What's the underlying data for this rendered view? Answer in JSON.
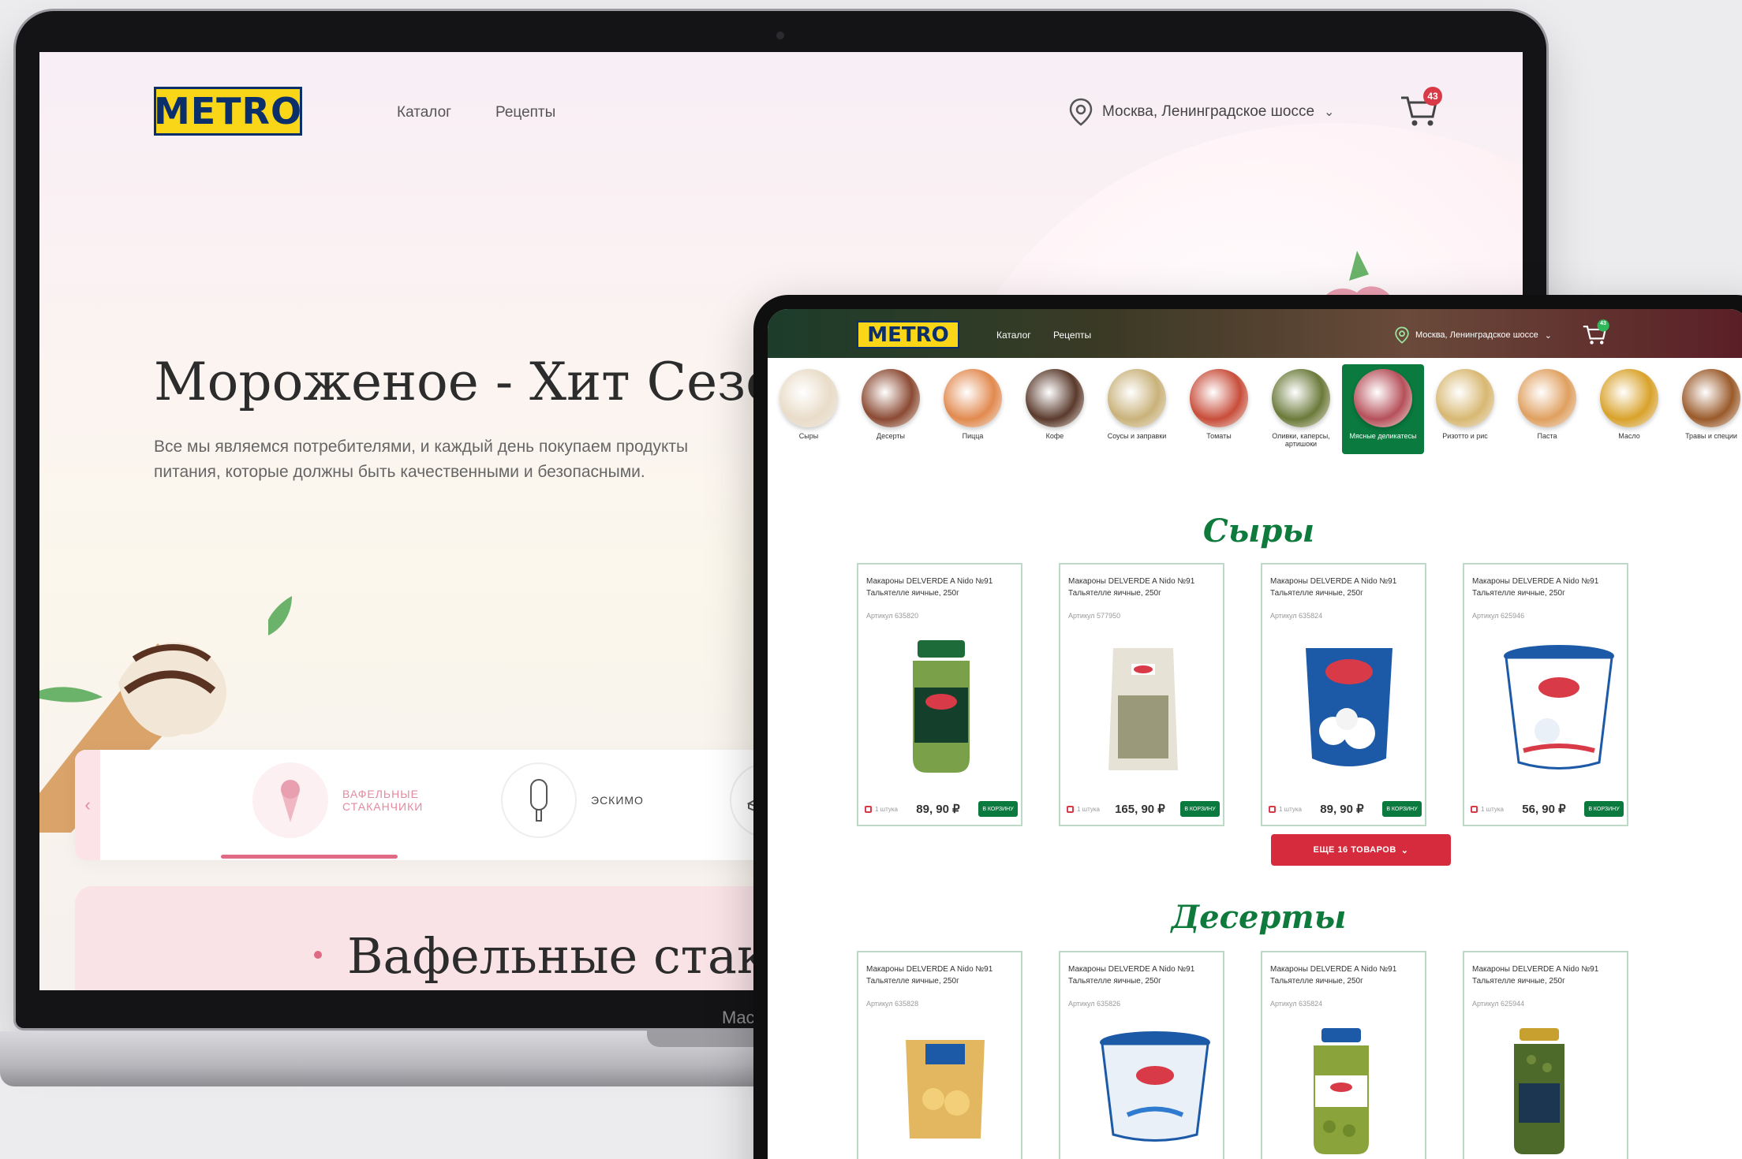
{
  "laptop": {
    "brand_text": "Mac",
    "logo": "METRO",
    "nav": [
      "Каталог",
      "Рецепты"
    ],
    "location": "Москва, Ленинградское шоссе",
    "cart_count": "43",
    "hero_title": "Мороженое - Хит Сезона",
    "hero_desc": "Все мы являемся потребителями, и каждый день покупаем продукты питания, которые должны быть качественными и безопасными.",
    "tabs": [
      {
        "label": "ВАФЕЛЬНЫЕ СТАКАНЧИКИ",
        "icon": "cone-icon",
        "active": true
      },
      {
        "label": "ЭСКИМО",
        "icon": "popsicle-icon",
        "active": false
      },
      {
        "label": "",
        "icon": "brick-icon",
        "active": false
      }
    ],
    "section_title": "Вафельные стаканчики",
    "colors": {
      "accent": "#e06a84",
      "logo_yellow": "#f9d617",
      "logo_blue": "#0b2f6a"
    }
  },
  "tablet": {
    "logo": "METRO",
    "nav": [
      "Каталог",
      "Рецепты"
    ],
    "location": "Москва, Ленинградское шоссе",
    "cart_count": "43",
    "categories": [
      {
        "label": "Сыры",
        "color": "#e9dcc8"
      },
      {
        "label": "Десерты",
        "color": "#8b4a33"
      },
      {
        "label": "Пицца",
        "color": "#e28a4f"
      },
      {
        "label": "Кофе",
        "color": "#5a3a2c"
      },
      {
        "label": "Соусы и заправки",
        "color": "#c9b27a"
      },
      {
        "label": "Томаты",
        "color": "#c84d3a"
      },
      {
        "label": "Оливки, каперсы, артишоки",
        "color": "#6b7a3a"
      },
      {
        "label": "Мясные деликатесы",
        "color": "#b6505a",
        "active": true
      },
      {
        "label": "Ризотто и рис",
        "color": "#d8b872"
      },
      {
        "label": "Паста",
        "color": "#e0a060"
      },
      {
        "label": "Масло",
        "color": "#d9a22a"
      },
      {
        "label": "Травы и специи",
        "color": "#9a5a2a"
      }
    ],
    "sections": [
      {
        "title": "Сыры",
        "products": [
          {
            "name": "Макароны DELVERDE A Nido №91 Тальятелле яичные, 250г",
            "sku": "Артикул 635820",
            "unit": "1 штука",
            "price": "89, 90 ₽",
            "button": "В КОРЗИНУ",
            "image": "pesto-jar"
          },
          {
            "name": "Макароны DELVERDE A Nido №91 Тальятелле яичные, 250г",
            "sku": "Артикул 577950",
            "unit": "1 штука",
            "price": "165, 90 ₽",
            "button": "В КОРЗИНУ",
            "image": "grated-bag"
          },
          {
            "name": "Макароны DELVERDE A Nido №91 Тальятелле яичные, 250г",
            "sku": "Артикул 635824",
            "unit": "1 штука",
            "price": "89, 90 ₽",
            "button": "В КОРЗИНУ",
            "image": "mozzarella-pack"
          },
          {
            "name": "Макароны DELVERDE A Nido №91 Тальятелле яичные, 250г",
            "sku": "Артикул 625946",
            "unit": "1 штука",
            "price": "56, 90 ₽",
            "button": "В КОРЗИНУ",
            "image": "mozzarella-tub"
          }
        ],
        "more_button": "ЕЩЕ 16 ТОВАРОВ"
      },
      {
        "title": "Десерты",
        "products": [
          {
            "name": "Макароны DELVERDE A Nido №91 Тальятелле яичные, 250г",
            "sku": "Артикул 635828",
            "image": "rana-pack"
          },
          {
            "name": "Макароны DELVERDE A Nido №91 Тальятелле яичные, 250г",
            "sku": "Артикул 635826",
            "image": "cream-tub"
          },
          {
            "name": "Макароны DELVERDE A Nido №91 Тальятелле яичные, 250г",
            "sku": "Артикул 635824",
            "image": "olive-jar"
          },
          {
            "name": "Макароны DELVERDE A Nido №91 Тальятелле яичные, 250г",
            "sku": "Артикул 625944",
            "image": "caper-jar"
          }
        ]
      }
    ],
    "colors": {
      "green": "#0a7a3f",
      "red": "#d52b3c",
      "title_green": "#0e7a3c"
    }
  }
}
